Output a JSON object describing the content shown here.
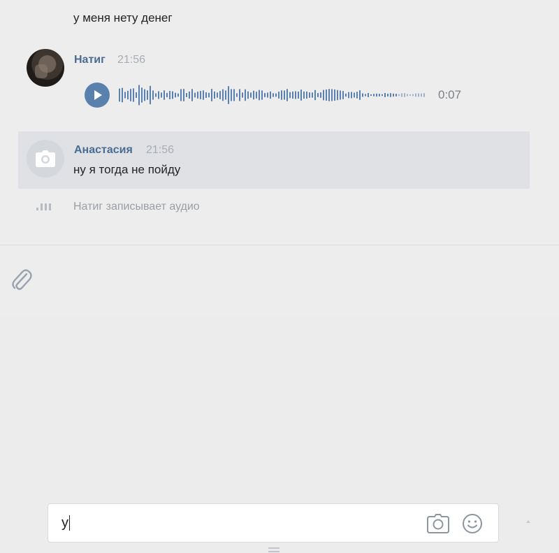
{
  "messages": {
    "prev_text": "у меня нету денег",
    "voice": {
      "author": "Натиг",
      "time": "21:56",
      "duration": "0:07"
    },
    "text_msg": {
      "author": "Анастасия",
      "time": "21:56",
      "text": "ну я тогда не пойду"
    }
  },
  "typing_indicator": "Натиг записывает аудио",
  "composer": {
    "input_value": "у"
  },
  "colors": {
    "accent": "#5a80ad",
    "author": "#4a6c93",
    "background": "#ededed",
    "highlight": "#dfe1e4"
  }
}
